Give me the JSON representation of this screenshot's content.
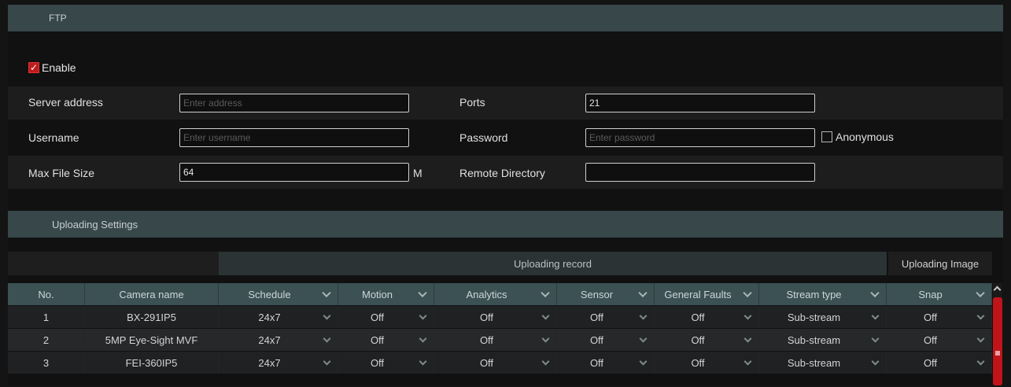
{
  "ftp": {
    "section_title": "FTP",
    "enable_label": "Enable",
    "enabled": true,
    "server_address": {
      "label": "Server address",
      "value": "",
      "placeholder": "Enter address"
    },
    "ports": {
      "label": "Ports",
      "value": "21"
    },
    "username": {
      "label": "Username",
      "value": "",
      "placeholder": "Enter username"
    },
    "password": {
      "label": "Password",
      "value": "",
      "placeholder": "Enter password"
    },
    "anonymous_label": "Anonymous",
    "max_file_size": {
      "label": "Max File Size",
      "value": "64",
      "unit": "M"
    },
    "remote_directory": {
      "label": "Remote Directory",
      "value": ""
    }
  },
  "uploading": {
    "section_title": "Uploading Settings",
    "group_record": "Uploading record",
    "group_image": "Uploading Image",
    "columns": [
      "No.",
      "Camera name",
      "Schedule",
      "Motion",
      "Analytics",
      "Sensor",
      "General Faults",
      "Stream type",
      "Snap"
    ],
    "rows": [
      {
        "no": "1",
        "camera": "BX-291IP5",
        "schedule": "24x7",
        "motion": "Off",
        "analytics": "Off",
        "sensor": "Off",
        "general": "Off",
        "stream": "Sub-stream",
        "snap": "Off"
      },
      {
        "no": "2",
        "camera": "5MP Eye-Sight MVF",
        "schedule": "24x7",
        "motion": "Off",
        "analytics": "Off",
        "sensor": "Off",
        "general": "Off",
        "stream": "Sub-stream",
        "snap": "Off"
      },
      {
        "no": "3",
        "camera": "FEI-360IP5",
        "schedule": "24x7",
        "motion": "Off",
        "analytics": "Off",
        "sensor": "Off",
        "general": "Off",
        "stream": "Sub-stream",
        "snap": "Off"
      }
    ]
  },
  "icons": {
    "checked": "check-icon",
    "dropdown": "chevron-down-icon",
    "scroll_up": "chevron-up-icon"
  },
  "colors": {
    "accent": "#c01b1b",
    "section_bar": "#37474a",
    "table_header": "#3b5154"
  }
}
